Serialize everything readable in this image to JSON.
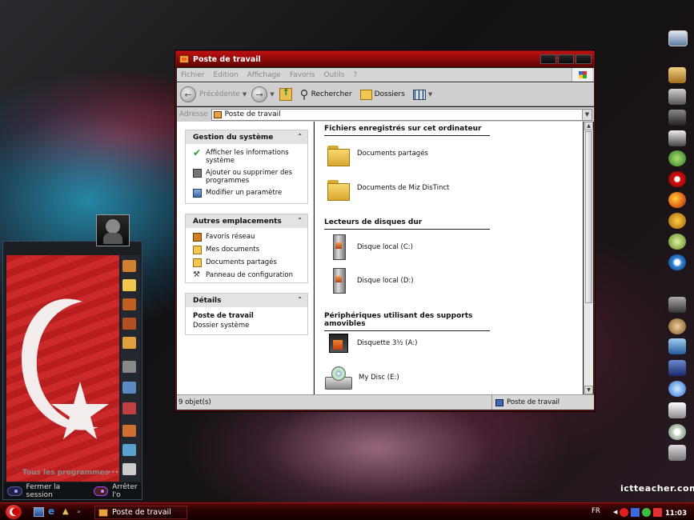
{
  "window": {
    "title": "Poste de travail",
    "menu": [
      "Fichier",
      "Edition",
      "Affichage",
      "Favoris",
      "Outils",
      "?"
    ],
    "toolbar": {
      "back_label": "Précédente",
      "search_label": "Rechercher",
      "folders_label": "Dossiers"
    },
    "address": {
      "label": "Adresse",
      "value": "Poste de travail"
    },
    "taskpane": {
      "system": {
        "title": "Gestion du système",
        "items": [
          {
            "label": "Afficher les informations système",
            "icon": "check-icon"
          },
          {
            "label": "Ajouter ou supprimer des programmes",
            "icon": "programs-icon"
          },
          {
            "label": "Modifier un paramètre",
            "icon": "control-icon"
          }
        ]
      },
      "places": {
        "title": "Autres emplacements",
        "items": [
          {
            "label": "Favoris réseau",
            "icon": "network-icon"
          },
          {
            "label": "Mes documents",
            "icon": "folder-icon"
          },
          {
            "label": "Documents partagés",
            "icon": "shared-folder-icon"
          },
          {
            "label": "Panneau de configuration",
            "icon": "wrench-icon"
          }
        ]
      },
      "details": {
        "title": "Détails",
        "name": "Poste de travail",
        "type": "Dossier système"
      }
    },
    "sections": [
      {
        "title": "Fichiers enregistrés sur cet ordinateur",
        "items": [
          "Documents partagés",
          "Documents de Miz DisTinct"
        ]
      },
      {
        "title": "Lecteurs de disques dur",
        "items": [
          "Disque local (C:)",
          "Disque local (D:)"
        ]
      },
      {
        "title": "Périphériques utilisant des supports amovibles",
        "items": [
          "Disquette 3½ (A:)",
          "My Disc (E:)"
        ]
      }
    ],
    "status": {
      "count": "9 objet(s)",
      "location": "Poste de travail"
    }
  },
  "start_menu": {
    "all_programs": "Tous les programmes",
    "logoff": "Fermer la session",
    "shutdown": "Arrêter l'o"
  },
  "taskbar": {
    "task": "Poste de travail",
    "language": "FR",
    "clock": "11:03"
  },
  "watermark": "ictteacher.com"
}
